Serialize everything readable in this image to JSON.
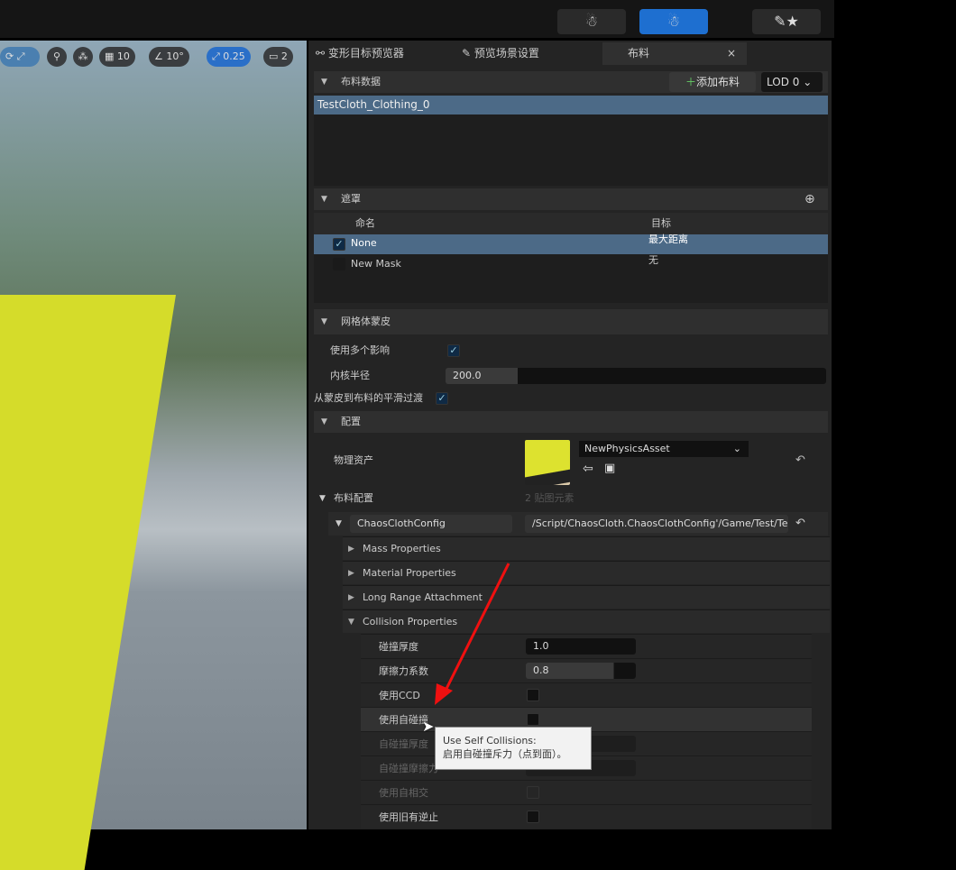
{
  "toolbar": {
    "snap_grid": "10",
    "snap_rot": "10°",
    "snap_scale": "0.25",
    "camera_speed": "2"
  },
  "tabs": [
    {
      "label": "变形目标预览器"
    },
    {
      "label": "预览场景设置"
    },
    {
      "label": "布料",
      "active": true
    }
  ],
  "cloth_data": {
    "title": "布料数据",
    "add_button": "添加布料",
    "lod": "LOD 0",
    "items": [
      "TestCloth_Clothing_0"
    ]
  },
  "masks": {
    "title": "遮罩",
    "col_name": "命名",
    "col_target": "目标",
    "rows": [
      {
        "name": "None",
        "target": "最大距离",
        "checked": true
      },
      {
        "name": "New Mask",
        "target": "无",
        "checked": false
      }
    ]
  },
  "skinning": {
    "title": "网格体蒙皮",
    "multi_label": "使用多个影响",
    "multi": true,
    "radius_label": "内核半径",
    "radius": "200.0",
    "smooth_label": "从蒙皮到布料的平滑过渡",
    "smooth": true
  },
  "config": {
    "title": "配置",
    "physics_label": "物理资产",
    "physics_value": "NewPhysicsAsset",
    "cloth_config_label": "布料配置",
    "cloth_config_count": "2 贴图元素",
    "chaos_label": "ChaosClothConfig",
    "chaos_path": "/Script/ChaosCloth.ChaosClothConfig'/Game/Test/Te"
  },
  "groups": [
    "Mass Properties",
    "Material Properties",
    "Long Range Attachment",
    "Collision Properties"
  ],
  "collision": [
    {
      "label": "碰撞厚度",
      "type": "num",
      "value": "1.0"
    },
    {
      "label": "摩擦力系数",
      "type": "num",
      "value": "0.8",
      "fill": 0.8
    },
    {
      "label": "使用CCD",
      "type": "cb"
    },
    {
      "label": "使用自碰撞",
      "type": "cb",
      "hover": true
    },
    {
      "label": "自碰撞厚度",
      "type": "num",
      "value": "",
      "disabled": true
    },
    {
      "label": "自碰撞摩擦力",
      "type": "num",
      "value": "",
      "disabled": true
    },
    {
      "label": "使用自相交",
      "type": "cb",
      "disabled": true
    },
    {
      "label": "使用旧有逆止",
      "type": "cb"
    }
  ],
  "tooltip": {
    "title": "Use Self Collisions:",
    "body": "启用自碰撞斥力（点到面）。"
  }
}
